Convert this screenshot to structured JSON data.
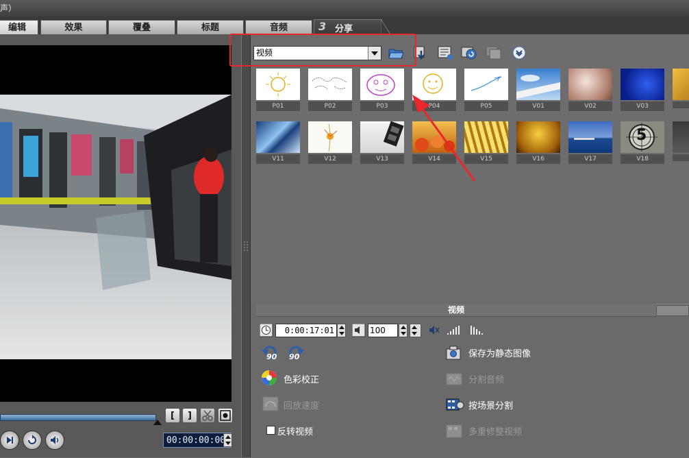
{
  "window": {
    "title_fragment": "声）"
  },
  "tabs": {
    "edit": "编辑",
    "effect": "效果",
    "overlay": "覆叠",
    "title": "标题",
    "audio": "音频",
    "share_number": "3",
    "share": "分享"
  },
  "preview": {
    "timecode": "00:00:00:00"
  },
  "library": {
    "category_value": "视频",
    "toolbar_icons": [
      "folder-open-icon",
      "import-icon",
      "list-view-icon",
      "sort-icon",
      "storyboard-icon",
      "expand-more-icon"
    ],
    "clips": [
      {
        "label": "P01",
        "style": "sun-sketch"
      },
      {
        "label": "P02",
        "style": "world-map"
      },
      {
        "label": "P03",
        "style": "face-doodle"
      },
      {
        "label": "P04",
        "style": "sun-face"
      },
      {
        "label": "P05",
        "style": "plane-doodle"
      },
      {
        "label": "V01",
        "style": "sky-wing"
      },
      {
        "label": "V02",
        "style": "soft-light"
      },
      {
        "label": "V03",
        "style": "blue-bokeh"
      },
      {
        "label": "V11",
        "style": "blue-crystal"
      },
      {
        "label": "V12",
        "style": "flower"
      },
      {
        "label": "V13",
        "style": "film-strip"
      },
      {
        "label": "V14",
        "style": "fruit"
      },
      {
        "label": "V15",
        "style": "gold-rays"
      },
      {
        "label": "V16",
        "style": "gold-bokeh"
      },
      {
        "label": "V17",
        "style": "sea"
      },
      {
        "label": "V18",
        "style": "countdown"
      }
    ],
    "countdown_digit": "5"
  },
  "options": {
    "header": "视频",
    "duration": "0:00:17:01",
    "volume": "100",
    "rotate_left_label": "90",
    "rotate_right_label": "90",
    "color_correction": "色彩校正",
    "playback_speed": "回放速度",
    "reverse_video": "反转视频",
    "save_still": "保存为静态图像",
    "split_audio": "分割音频",
    "split_by_scene": "按场景分割",
    "multi_trim": "多重修整视频"
  },
  "colors": {
    "highlight": "#e8282a",
    "arrow": "#e8282a"
  }
}
